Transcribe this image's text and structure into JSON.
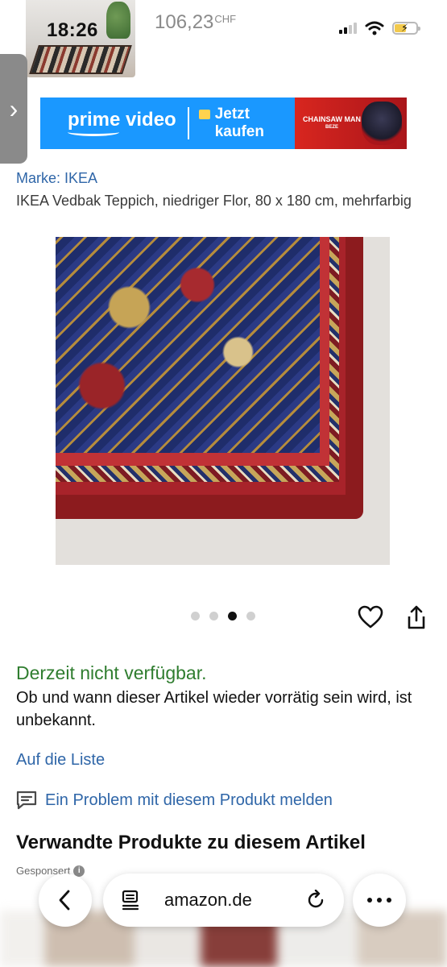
{
  "status_bar": {
    "time": "18:26",
    "price": "106,23",
    "currency": "CHF"
  },
  "ad": {
    "brand": "prime video",
    "cta_line1": "Jetzt",
    "cta_line2": "kaufen",
    "show": "CHAINSAW MAN",
    "show_sub": "BEZE"
  },
  "product": {
    "brand_label": "Marke: IKEA",
    "title": "IKEA Vedbak Teppich, niedriger Flor, 80 x 180 cm, mehrfarbig",
    "image_dots": {
      "count": 4,
      "active_index": 2
    }
  },
  "availability": {
    "status": "Derzeit nicht verfügbar.",
    "note": "Ob und wann dieser Artikel wieder vorrätig sein wird, ist unbekannt."
  },
  "actions": {
    "wishlist": "Auf die Liste",
    "report": "Ein Problem mit diesem Produkt melden"
  },
  "related": {
    "heading": "Verwandte Produkte zu diesem Artikel",
    "sponsored": "Gesponsert"
  },
  "browser": {
    "url": "amazon.de"
  },
  "colors": {
    "link": "#2f66a8",
    "available_green": "#2f7d2f",
    "ad_blue": "#1a98ff"
  }
}
